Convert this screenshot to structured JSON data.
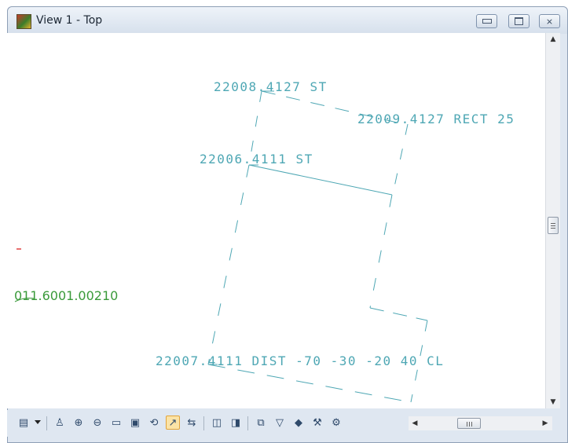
{
  "window": {
    "title": "View 1 - Top"
  },
  "colors": {
    "drawing": "#4ea7b4",
    "green_text": "#3a9a3a",
    "red_mark": "#e04040"
  },
  "canvas": {
    "labels": {
      "top": "22008.4127 ST",
      "right": "22009.4127 RECT 25",
      "mid": "22006.4111 ST",
      "bottom": "22007.4111 DIST -70 -30 -20 40 CL",
      "left": "011.6001.00210"
    }
  },
  "icons": {
    "window_buttons": [
      "minimize-icon",
      "restore-icon",
      "close-icon"
    ],
    "toolbar": [
      "view-attributes-icon",
      "update-view-icon",
      "zoom-in-icon",
      "zoom-out-icon",
      "window-area-icon",
      "fit-view-icon",
      "rotate-view-icon",
      "pan-view-icon",
      "view-previous-icon",
      "view-next-icon",
      "copy-view-icon",
      "clip-volume-icon",
      "camera-icon",
      "view-display-mode-icon",
      "tool-settings-icon"
    ]
  },
  "window_buttons": {
    "close": "⨯"
  }
}
